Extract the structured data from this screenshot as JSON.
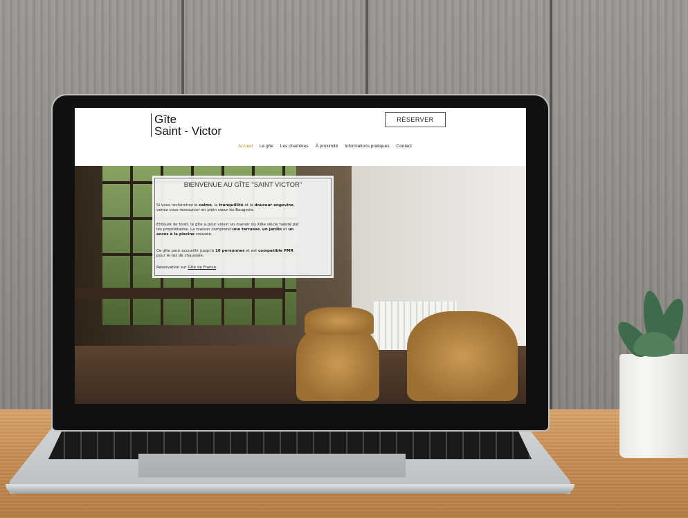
{
  "site": {
    "logo_line1": "Gîte",
    "logo_line2": "Saint - Victor",
    "reserve_label": "RÉSERVER",
    "nav": [
      {
        "label": "Accueil",
        "active": true
      },
      {
        "label": "Le gîte",
        "active": false
      },
      {
        "label": "Les chambres",
        "active": false
      },
      {
        "label": "À proximité",
        "active": false
      },
      {
        "label": "Informations pratiques",
        "active": false
      },
      {
        "label": "Contact",
        "active": false
      }
    ]
  },
  "welcome": {
    "title": "BIENVENUE AU GÎTE \"SAINT VICTOR\"",
    "p1_a": "Si vous recherchez le ",
    "p1_b": "calme",
    "p1_c": ", la ",
    "p1_d": "tranquillité",
    "p1_e": " et la ",
    "p1_f": "douceur angevine",
    "p1_g": ",",
    "p1_h": "venez vous ressourcer en plein cœur du Baugeois.",
    "p2_a": "Entouré de forêt, le gîte a pour voisin un manoir du XIIIe siècle habité par",
    "p2_b": "les propriétaires. La maison comprend ",
    "p2_c": "une terrasse",
    "p2_d": ", ",
    "p2_e": "un jardin",
    "p2_f": " et ",
    "p2_g": "un",
    "p2_h": "accès à la piscine",
    "p2_i": " creusée.",
    "p3_a": "Ce gîte peut accueillir jusqu'à ",
    "p3_b": "10 personnes",
    "p3_c": " et est ",
    "p3_d": "compatible PMR",
    "p3_e": "pour le rez de chaussée.",
    "p4_a": "Réservation sur ",
    "p4_link": "Gîte de France",
    "p4_b": "."
  },
  "colors": {
    "accent": "#b48b1e"
  }
}
